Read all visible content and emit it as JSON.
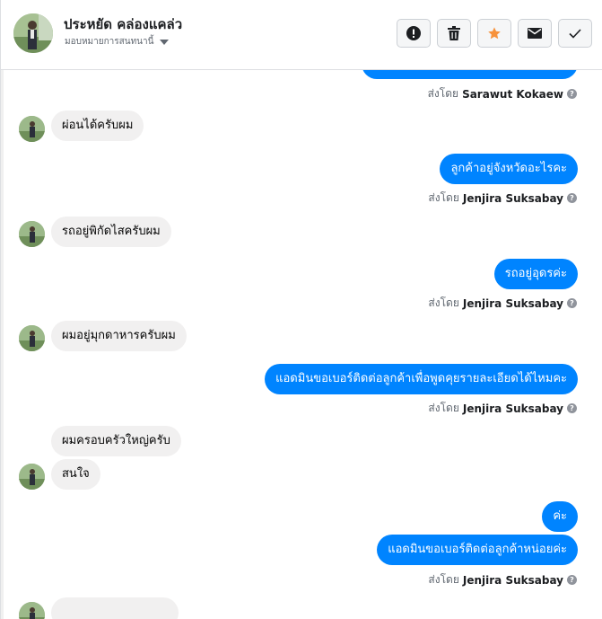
{
  "header": {
    "contact_name": "ประหยัด คล่องแคล่ว",
    "assign_label": "มอบหมายการสนทนานี้",
    "actions": [
      {
        "name": "report",
        "icon": "exclamation-circle-icon"
      },
      {
        "name": "delete",
        "icon": "trash-icon"
      },
      {
        "name": "star",
        "icon": "star-icon"
      },
      {
        "name": "mark-unread",
        "icon": "envelope-icon"
      },
      {
        "name": "mark-done",
        "icon": "checkmark-icon"
      }
    ]
  },
  "colors": {
    "outgoing": "#0084ff",
    "incoming": "#f1f0f0",
    "star": "#f7923b"
  },
  "messages": {
    "m0": {
      "sent_prefix": "ส่งโดย",
      "sender": "Sarawut Kokaew"
    },
    "m1": {
      "text": "ผ่อนได้ครับผม"
    },
    "m2": {
      "text": "ลูกค้าอยู่จังหวัดอะไรคะ",
      "sent_prefix": "ส่งโดย",
      "sender": "Jenjira Suksabay"
    },
    "m3": {
      "text": "รถอยู่พิกัดไสครับผม"
    },
    "m4": {
      "text": "รถอยู่อุดรค่ะ",
      "sent_prefix": "ส่งโดย",
      "sender": "Jenjira Suksabay"
    },
    "m5": {
      "text": "ผมอยู่มุกดาหารครับผม"
    },
    "m6": {
      "text": "แอดมินขอเบอร์ติดต่อลูกค้าเพื่อพูดคุยรายละเอียดได้ไหมคะ",
      "sent_prefix": "ส่งโดย",
      "sender": "Jenjira Suksabay"
    },
    "m7": {
      "text": "ผมครอบครัวใหญ่ครับ"
    },
    "m8": {
      "text": "สนใจ"
    },
    "m9": {
      "text": "ค่ะ"
    },
    "m10": {
      "text": "แอดมินขอเบอร์ติดต่อลูกค้าหน่อยค่ะ",
      "sent_prefix": "ส่งโดย",
      "sender": "Jenjira Suksabay"
    }
  }
}
